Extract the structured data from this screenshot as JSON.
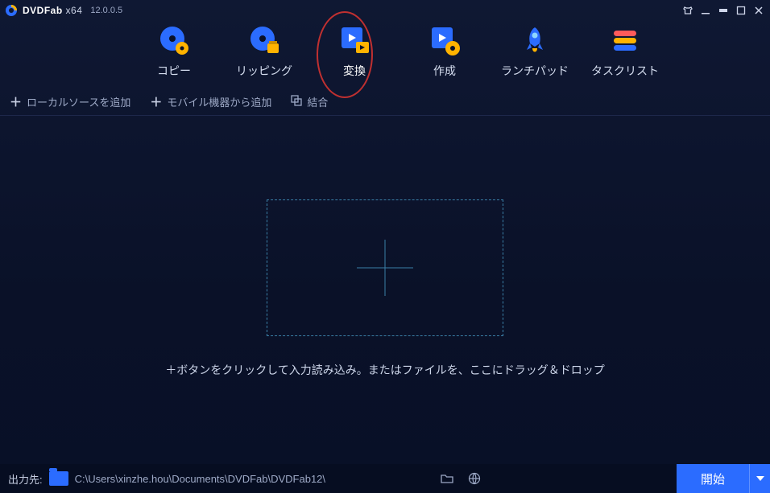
{
  "app": {
    "name": "DVDFab",
    "arch": "x64",
    "version": "12.0.0.5"
  },
  "tabs": [
    {
      "label": "コピー"
    },
    {
      "label": "リッピング"
    },
    {
      "label": "変換"
    },
    {
      "label": "作成"
    },
    {
      "label": "ランチパッド"
    },
    {
      "label": "タスクリスト"
    }
  ],
  "active_tab_index": 2,
  "toolbar": {
    "add_local": "ローカルソースを追加",
    "add_mobile": "モバイル機器から追加",
    "merge": "結合"
  },
  "dropzone": {
    "hint": "＋ボタンをクリックして入力読み込み。またはファイルを、ここにドラッグ＆ドロップ"
  },
  "footer": {
    "out_label": "出力先:",
    "out_path": "C:\\Users\\xinzhe.hou\\Documents\\DVDFab\\DVDFab12\\",
    "start_label": "開始"
  },
  "colors": {
    "accent": "#2b6cff",
    "highlight": "#c03030"
  }
}
